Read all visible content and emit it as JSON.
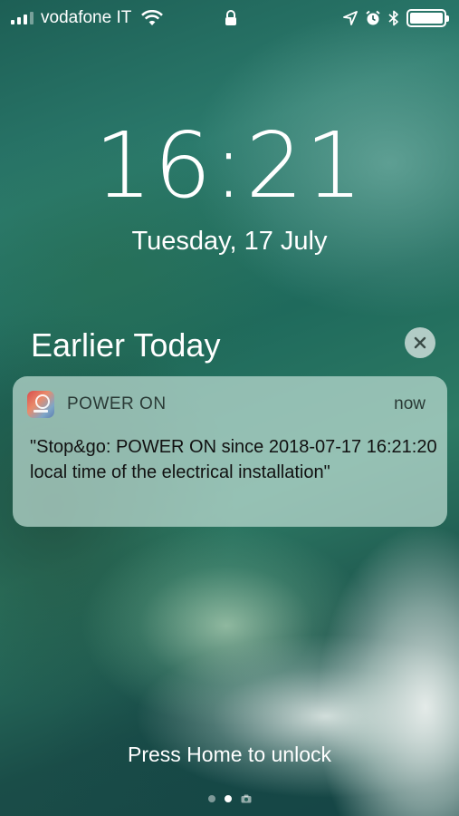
{
  "status_bar": {
    "carrier": "vodafone IT",
    "signal_bars_filled": 3,
    "signal_bars_total": 5,
    "icons": [
      "signal-icon",
      "wifi-icon",
      "lock-icon",
      "location-icon",
      "alarm-icon",
      "bluetooth-icon",
      "battery-icon"
    ],
    "battery_level": 1.0
  },
  "lock_screen": {
    "time": "16:21",
    "date": "Tuesday, 17 July",
    "section_title": "Earlier Today",
    "unlock_hint": "Press Home to unlock"
  },
  "notification": {
    "app_name": "POWER ON",
    "time": "now",
    "body": "\"Stop&go: POWER ON since 2018-07-17 16:21:20 local time of the electrical installation\""
  },
  "pager": {
    "pages": 3,
    "active_index": 1
  }
}
